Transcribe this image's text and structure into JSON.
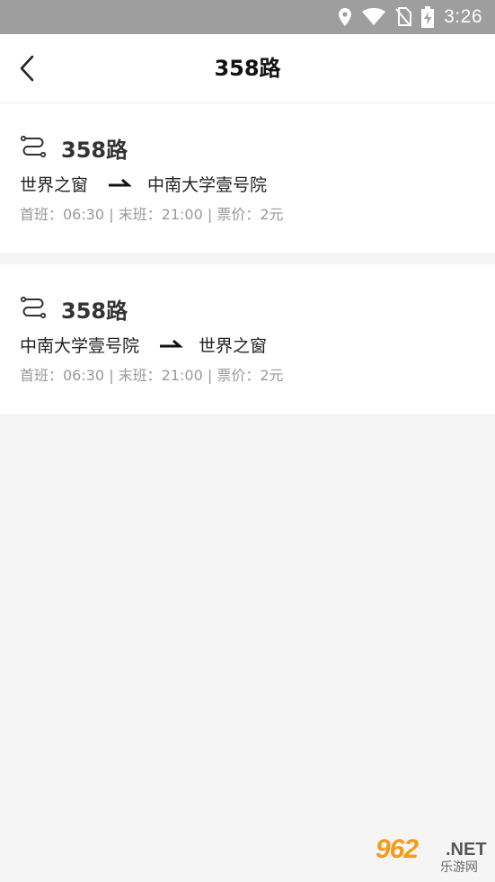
{
  "status_bar": {
    "time": "3:26",
    "icons": [
      "location-icon",
      "wifi-icon",
      "no-sim-icon",
      "battery-charging-icon"
    ]
  },
  "header": {
    "title": "358路",
    "back_icon": "chevron-left-icon"
  },
  "routes": [
    {
      "name": "358路",
      "from": "世界之窗",
      "to": "中南大学壹号院",
      "info": "首班：06:30 | 末班：21:00 | 票价：2元"
    },
    {
      "name": "358路",
      "from": "中南大学壹号院",
      "to": "世界之窗",
      "info": "首班：06:30 | 末班：21:00 | 票价：2元"
    }
  ],
  "watermark": {
    "brand": "962",
    "suffix": ".NET",
    "subtitle": "乐游网"
  },
  "colors": {
    "status_bar": "#9e9e9e",
    "background": "#f5f5f5",
    "card": "#ffffff",
    "info_text": "#999999",
    "title_text": "#111111"
  }
}
